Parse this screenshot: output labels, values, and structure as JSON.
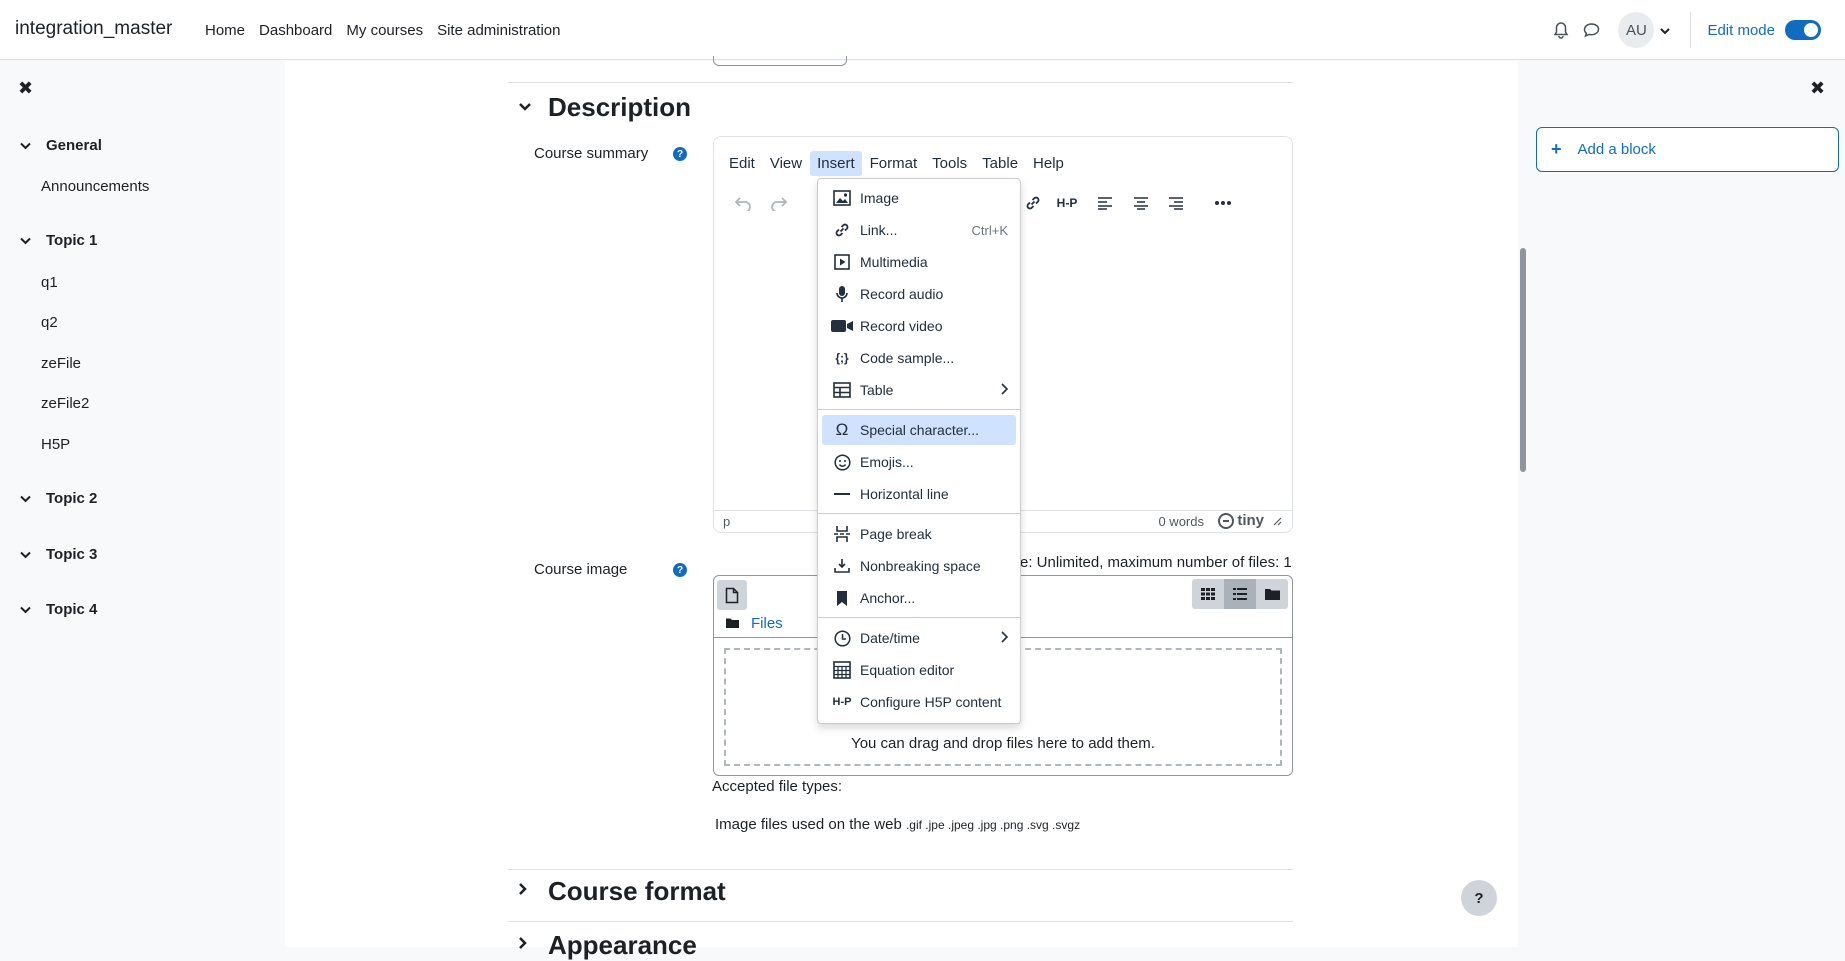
{
  "navbar": {
    "brand": "integration_master",
    "links": [
      "Home",
      "Dashboard",
      "My courses",
      "Site administration"
    ],
    "avatar_initials": "AU",
    "edit_mode_label": "Edit mode",
    "edit_mode_on": true
  },
  "course_index": {
    "sections": [
      {
        "title": "General",
        "items": [
          "Announcements"
        ]
      },
      {
        "title": "Topic 1",
        "items": [
          "q1",
          "q2",
          "zeFile",
          "zeFile2",
          "H5P"
        ]
      },
      {
        "title": "Topic 2",
        "items": []
      },
      {
        "title": "Topic 3",
        "items": []
      },
      {
        "title": "Topic 4",
        "items": []
      }
    ]
  },
  "form": {
    "description_heading": "Description",
    "course_summary_label": "Course summary",
    "course_image_label": "Course image",
    "course_format_heading": "Course format",
    "appearance_heading": "Appearance",
    "help_glyph": "?"
  },
  "editor": {
    "menus": [
      "Edit",
      "View",
      "Insert",
      "Format",
      "Tools",
      "Table",
      "Help"
    ],
    "active_menu": "Insert",
    "status_path": "p",
    "word_count": "0 words",
    "brand": "tiny"
  },
  "insert_menu": {
    "items": [
      {
        "label": "Image",
        "icon": "image-icon"
      },
      {
        "label": "Link...",
        "icon": "link-icon",
        "shortcut": "Ctrl+K"
      },
      {
        "label": "Multimedia",
        "icon": "multimedia-icon"
      },
      {
        "label": "Record audio",
        "icon": "microphone-icon"
      },
      {
        "label": "Record video",
        "icon": "video-camera-icon"
      },
      {
        "label": "Code sample...",
        "icon": "code-sample-icon"
      },
      {
        "label": "Table",
        "icon": "table-icon",
        "submenu": true
      },
      {
        "label": "Special character...",
        "icon": "omega-icon",
        "highlighted": true
      },
      {
        "label": "Emojis...",
        "icon": "emoji-icon"
      },
      {
        "label": "Horizontal line",
        "icon": "horizontal-line-icon"
      },
      {
        "label": "Page break",
        "icon": "page-break-icon"
      },
      {
        "label": "Nonbreaking space",
        "icon": "nonbreaking-space-icon"
      },
      {
        "label": "Anchor...",
        "icon": "bookmark-icon"
      },
      {
        "label": "Date/time",
        "icon": "clock-icon",
        "submenu": true
      },
      {
        "label": "Equation editor",
        "icon": "calculator-icon"
      },
      {
        "label": "Configure H5P content",
        "icon": "h5p-icon"
      }
    ]
  },
  "filepicker": {
    "max_size_text": "e: Unlimited, maximum number of files: 1",
    "path_label": "Files",
    "drop_message": "You can drag and drop files here to add them.",
    "accepted_label": "Accepted file types:",
    "image_types_label": "Image files used on the web",
    "image_types_ext": ".gif .jpe .jpeg .jpg .png .svg .svgz"
  },
  "right_drawer": {
    "add_block_label": "Add a block"
  },
  "close_glyph": "✖",
  "help_fab": "?"
}
